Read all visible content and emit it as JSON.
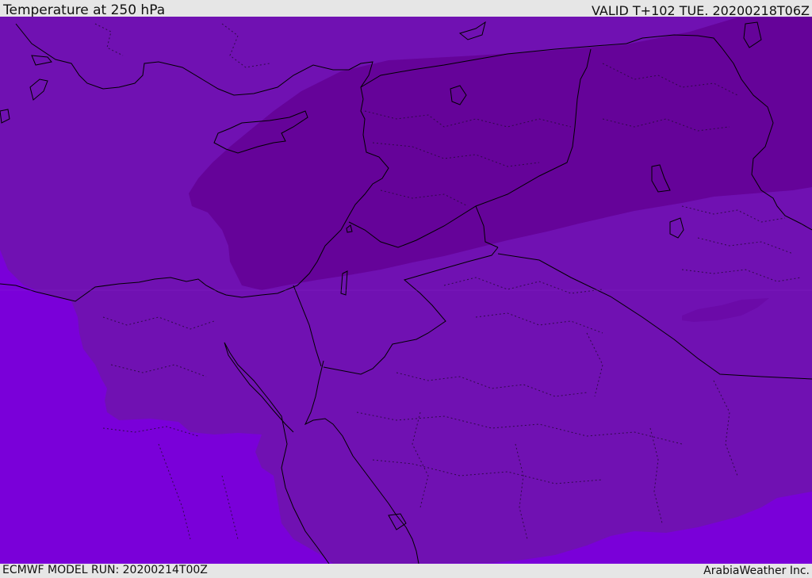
{
  "header": {
    "title": "Temperature at 250 hPa",
    "valid": "VALID T+102 TUE. 20200218T06Z"
  },
  "footer": {
    "model_run": "ECMWF MODEL RUN: 20200214T00Z",
    "credit": "ArabiaWeather Inc."
  },
  "map": {
    "colors": {
      "band_warm": "#7a00d9",
      "band_mid": "#7011b2",
      "band_cold": "#650399",
      "coast": "#000000",
      "border": "#000000",
      "admin": "#2a0a40"
    }
  }
}
